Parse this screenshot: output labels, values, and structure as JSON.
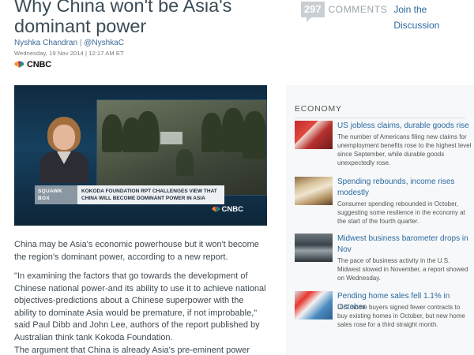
{
  "article": {
    "headline": "Why China won't be Asia's dominant power",
    "author": "Nyshka Chandran",
    "separator": "|",
    "handle": "@NyshkaC",
    "dateline": "Wednesday, 19 Nov 2014 | 12:17 AM ET",
    "brand": "CNBC",
    "paragraphs": [
      "China may be Asia's economic powerhouse but it won't become the region's dominant power, according to a new report.",
      "\"In examining the factors that go towards the development of Chinese national power-and its ability to use it to achieve national objectives-predictions about a Chinese superpower with the ability to dominate Asia would be premature, if not improbable,\" said Paul Dibb and John Lee, authors of the report published by Australian think tank Kokoda Foundation.",
      "The argument that China is already Asia's pre-eminent power based on"
    ]
  },
  "comments": {
    "count": "297",
    "label": "COMMENTS",
    "join": "Join the Discussion"
  },
  "video": {
    "show_line1": "SQUAWK",
    "show_line2": "BOX",
    "ticker": "KOKODA FOUNDATION RPT CHALLENGES VIEW THAT CHINA WILL BECOME DOMINANT POWER IN ASIA",
    "brand": "CNBC"
  },
  "sidebar": {
    "section": "ECONOMY",
    "stories": [
      {
        "title": "US jobless claims, durable goods rise",
        "summary": "The number of Americans filing new claims for unemployment benefits rose to the highest level since September, while durable goods unexpectedly rose."
      },
      {
        "title": "Spending rebounds, income rises modestly",
        "summary": "Consumer spending rebounded in October, suggesting some resilience in the economy at the start of the fourth quarter."
      },
      {
        "title": "Midwest business barometer drops in Nov",
        "summary": "The pace of business activity in the U.S. Midwest slowed in November, a report showed on Wednesday."
      },
      {
        "title": "Pending home sales fell 1.1% in October",
        "summary": "U.S. home buyers signed fewer contracts to buy existing homes in October, but new home sales rose for a third straight month."
      }
    ]
  },
  "colors": {
    "link": "#2b6aa0",
    "headline": "#3c4c57"
  }
}
